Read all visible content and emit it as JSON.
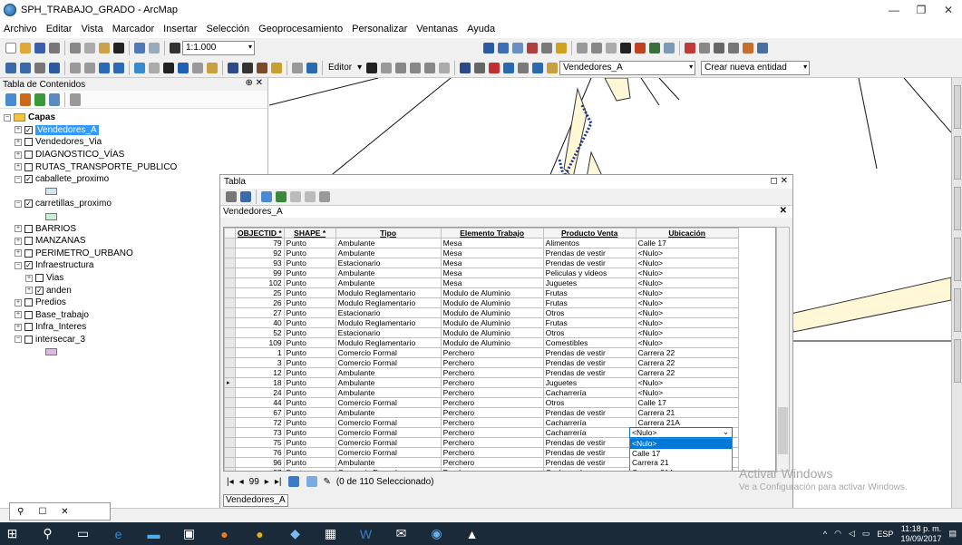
{
  "window": {
    "title": "SPH_TRABAJO_GRADO - ArcMap",
    "controls": [
      "—",
      "❐",
      "✕"
    ]
  },
  "menu": [
    "Archivo",
    "Editar",
    "Vista",
    "Marcador",
    "Insertar",
    "Selección",
    "Geoprocesamiento",
    "Personalizar",
    "Ventanas",
    "Ayuda"
  ],
  "toolbar": {
    "scale": "1:1.000",
    "editor_label": "Editor",
    "target_layer": "Vendedores_A",
    "create_label": "Crear nueva entidad"
  },
  "toc": {
    "title": "Tabla de Contenidos",
    "pin": "⊕ ✕",
    "layers_root": "Capas",
    "items": [
      {
        "label": "Vendedores_A",
        "checked": "✓",
        "exp": "+",
        "indent": 1,
        "selected": true
      },
      {
        "label": "Vendedores_Via",
        "checked": "",
        "exp": "+",
        "indent": 1
      },
      {
        "label": "DIAGNOSTICO_VÍAS",
        "checked": "",
        "exp": "+",
        "indent": 1
      },
      {
        "label": "RUTAS_TRANSPORTE_PUBLICO",
        "checked": "",
        "exp": "+",
        "indent": 1
      },
      {
        "label": "caballete_proximo",
        "checked": "✓",
        "exp": "−",
        "indent": 1
      },
      {
        "label": "",
        "swatch": "#cfe8f7",
        "indent": 2
      },
      {
        "label": "carretillas_proximo",
        "checked": "✓",
        "exp": "−",
        "indent": 1
      },
      {
        "label": "",
        "swatch": "#c8f0d4",
        "indent": 2
      },
      {
        "label": "BARRIOS",
        "checked": "",
        "exp": "+",
        "indent": 1
      },
      {
        "label": "MANZANAS",
        "checked": "",
        "exp": "+",
        "indent": 1
      },
      {
        "label": "PERIMETRO_URBANO",
        "checked": "",
        "exp": "+",
        "indent": 1
      },
      {
        "label": "Infraestructura",
        "checked": "✓",
        "exp": "−",
        "indent": 1
      },
      {
        "label": "Vias",
        "checked": "",
        "exp": "+",
        "indent": 2
      },
      {
        "label": "anden",
        "checked": "✓",
        "exp": "+",
        "indent": 2
      },
      {
        "label": "Predios",
        "checked": "",
        "exp": "+",
        "indent": 1
      },
      {
        "label": "Base_trabajo",
        "checked": "",
        "exp": "+",
        "indent": 1
      },
      {
        "label": "Infra_Interes",
        "checked": "",
        "exp": "+",
        "indent": 1
      },
      {
        "label": "intersecar_3",
        "checked": "",
        "exp": "−",
        "indent": 1
      },
      {
        "label": "",
        "swatch": "#e0b8e8",
        "indent": 2
      }
    ]
  },
  "table": {
    "window_title": "Tabla",
    "controls": "◻ ✕",
    "tab_title": "Vendedores_A",
    "columns": [
      "OBJECTID *",
      "SHAPE *",
      "Tipo",
      "Elemento Trabajo",
      "Producto Venta",
      "Ubicación"
    ],
    "rows": [
      [
        "79",
        "Punto",
        "Ambulante",
        "Mesa",
        "Alimentos",
        "Calle 17"
      ],
      [
        "92",
        "Punto",
        "Ambulante",
        "Mesa",
        "Prendas de vestir",
        "<Nulo>"
      ],
      [
        "93",
        "Punto",
        "Estacionario",
        "Mesa",
        "Prendas de vestir",
        "<Nulo>"
      ],
      [
        "99",
        "Punto",
        "Ambulante",
        "Mesa",
        "Peliculas y videos",
        "<Nulo>"
      ],
      [
        "102",
        "Punto",
        "Ambulante",
        "Mesa",
        "Juguetes",
        "<Nulo>"
      ],
      [
        "25",
        "Punto",
        "Modulo Reglamentario",
        "Modulo de Aluminio",
        "Frutas",
        "<Nulo>"
      ],
      [
        "26",
        "Punto",
        "Modulo Reglamentario",
        "Modulo de Aluminio",
        "Frutas",
        "<Nulo>"
      ],
      [
        "27",
        "Punto",
        "Estacionario",
        "Modulo de Aluminio",
        "Otros",
        "<Nulo>"
      ],
      [
        "40",
        "Punto",
        "Modulo Reglamentario",
        "Modulo de Aluminio",
        "Frutas",
        "<Nulo>"
      ],
      [
        "52",
        "Punto",
        "Estacionario",
        "Modulo de Aluminio",
        "Otros",
        "<Nulo>"
      ],
      [
        "109",
        "Punto",
        "Modulo Reglamentario",
        "Modulo de Aluminio",
        "Comestibles",
        "<Nulo>"
      ],
      [
        "1",
        "Punto",
        "Comercio Formal",
        "Perchero",
        "Prendas de vestir",
        "Carrera 22"
      ],
      [
        "3",
        "Punto",
        "Comercio Formal",
        "Perchero",
        "Prendas de vestir",
        "Carrera 22"
      ],
      [
        "12",
        "Punto",
        "Ambulante",
        "Perchero",
        "Prendas de vestir",
        "Carrera 22"
      ],
      [
        "18",
        "Punto",
        "Ambulante",
        "Perchero",
        "Juguetes",
        "<Nulo>"
      ],
      [
        "24",
        "Punto",
        "Ambulante",
        "Perchero",
        "Cacharrería",
        "<Nulo>"
      ],
      [
        "44",
        "Punto",
        "Comercio Formal",
        "Perchero",
        "Otros",
        "Calle 17"
      ],
      [
        "67",
        "Punto",
        "Ambulante",
        "Perchero",
        "Prendas de vestir",
        "Carrera 21"
      ],
      [
        "72",
        "Punto",
        "Comercio Formal",
        "Perchero",
        "Cacharrería",
        "Carrera 21A"
      ],
      [
        "73",
        "Punto",
        "Comercio Formal",
        "Perchero",
        "Cacharrería",
        "Carrera 22"
      ],
      [
        "75",
        "Punto",
        "Comercio Formal",
        "Perchero",
        "Prendas de vestir",
        "Calle 17"
      ],
      [
        "76",
        "Punto",
        "Comercio Formal",
        "Perchero",
        "Prendas de vestir",
        "Calle 17"
      ],
      [
        "96",
        "Punto",
        "Ambulante",
        "Perchero",
        "Prendas de vestir",
        "Calle 17"
      ],
      [
        "97",
        "Punto",
        "Comercio Formal",
        "Perchero",
        "Cacharrería",
        "Calle 17"
      ]
    ],
    "current_row_index": 14,
    "dropdown": {
      "current": "<Nulo>",
      "options": [
        "<Nulo>",
        "Calle 17",
        "Carrera 21",
        "Carrera 21A",
        "Carrera 22"
      ]
    },
    "nav": {
      "current": "99",
      "selection_status": "(0 de 110 Seleccionado)"
    },
    "footer_tab": "Vendedores_A"
  },
  "watermark": {
    "line1": "Activar Windows",
    "line2": "Ve a Configuración para activar Windows."
  },
  "taskbar": {
    "lang": "ESP",
    "time": "11:18 p. m.",
    "date": "19/09/2017"
  }
}
